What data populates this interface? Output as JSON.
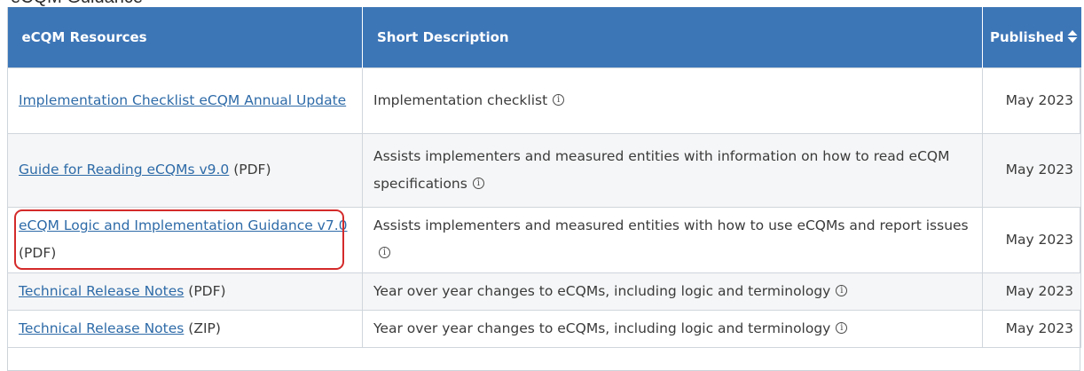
{
  "page": {
    "heading": "eCQM Guidance"
  },
  "table": {
    "headers": {
      "resources": "eCQM Resources",
      "description": "Short Description",
      "published": "Published"
    },
    "rows": [
      {
        "link": "Implementation Checklist eCQM Annual Update",
        "suffix": "",
        "description": "Implementation checklist",
        "published": "May 2023"
      },
      {
        "link": "Guide for Reading eCQMs v9.0",
        "suffix": " (PDF)",
        "description": "Assists implementers and measured entities with information on how to read eCQM specifications",
        "published": "May 2023"
      },
      {
        "link": "eCQM Logic and Implementation Guidance v7.0",
        "suffix": " (PDF)",
        "description": "Assists implementers and measured entities with how to use eCQMs and report issues",
        "published": "May 2023"
      },
      {
        "link": "Technical Release Notes",
        "suffix": " (PDF)",
        "description": "Year over year changes to eCQMs, including logic and terminology",
        "published": "May 2023"
      },
      {
        "link": "Technical Release Notes",
        "suffix": " (ZIP)",
        "description": "Year over year changes to eCQMs, including logic and terminology",
        "published": "May 2023"
      }
    ]
  },
  "icons": {
    "info": "info-circle-icon",
    "sort": "sort-updown-icon",
    "info_glyph": "i"
  },
  "colors": {
    "header_bg": "#3d76b7",
    "link": "#2e6ba8",
    "highlight": "#d42a2a",
    "row_shade": "#f5f6f7"
  }
}
